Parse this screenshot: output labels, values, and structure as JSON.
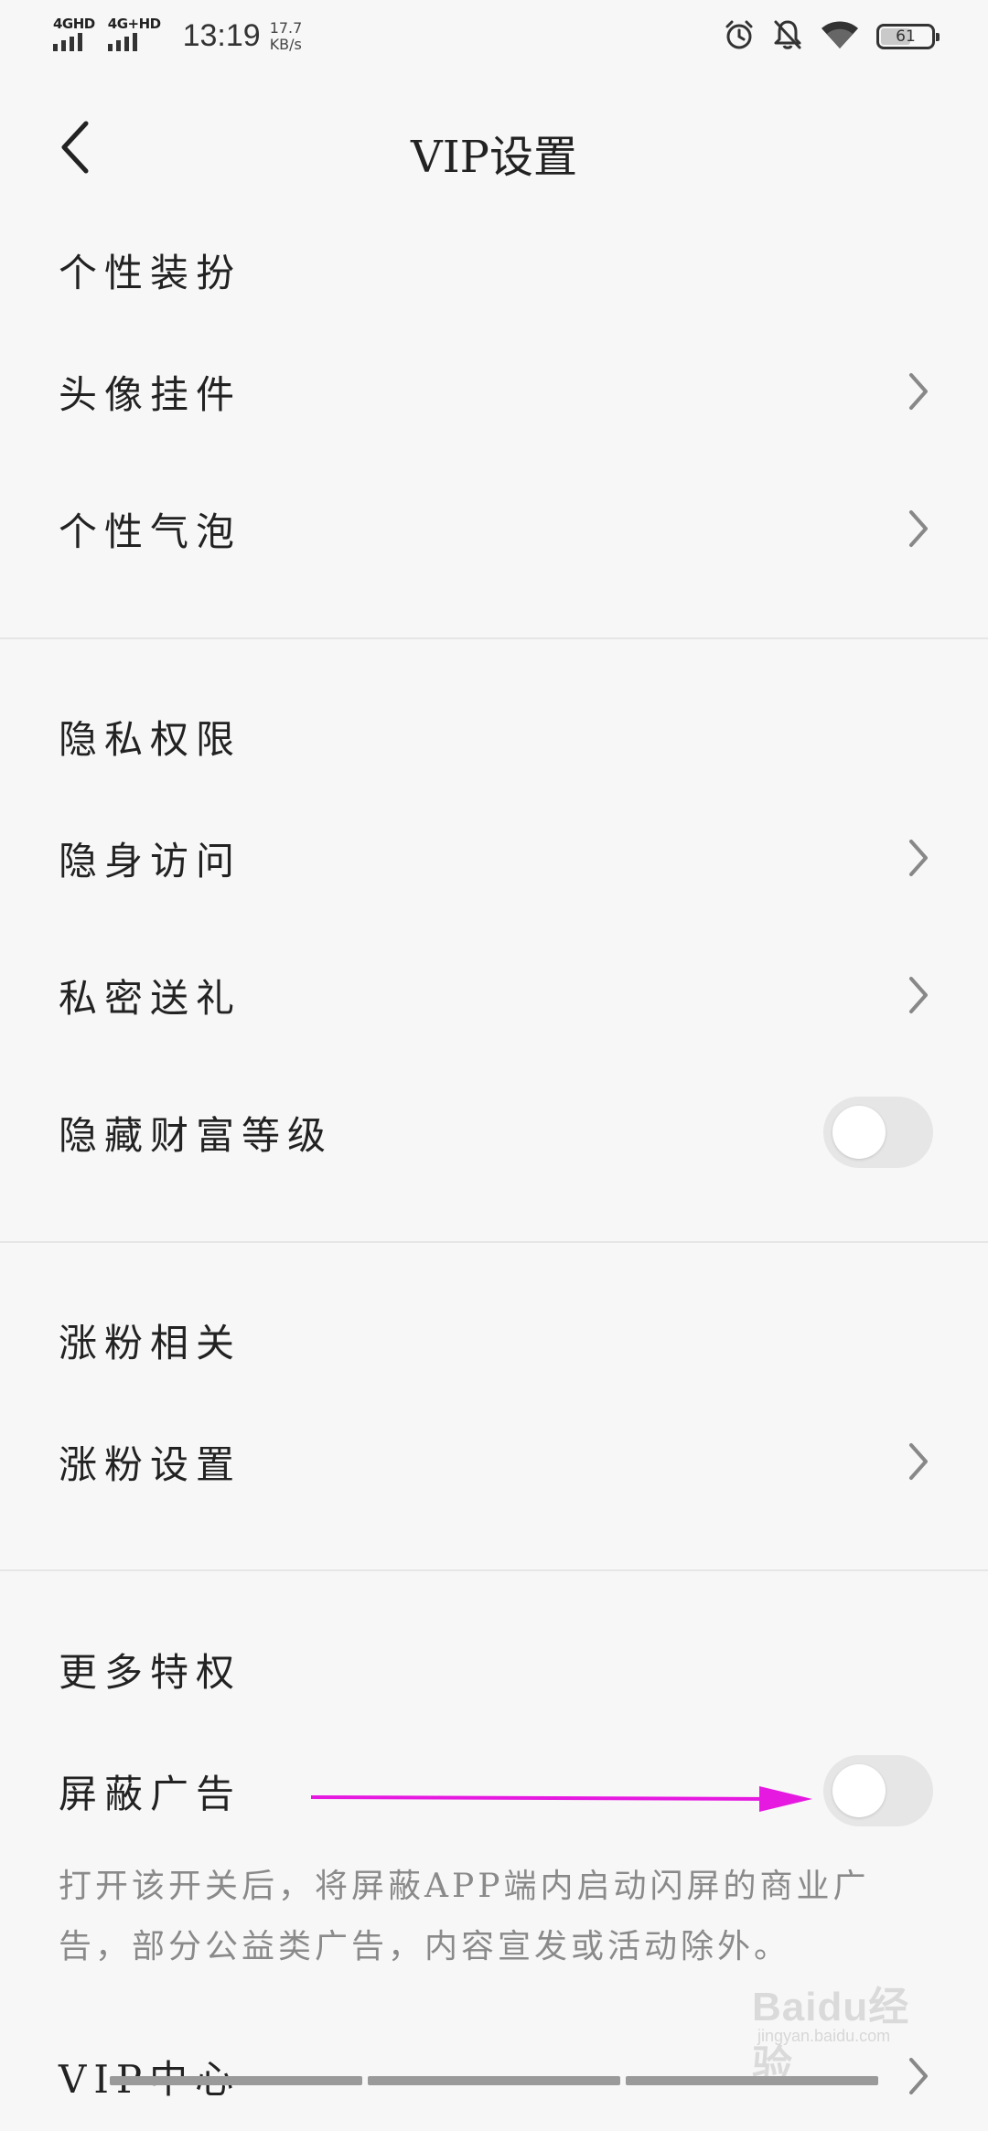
{
  "status_bar": {
    "network1": "4GHD",
    "network2": "4G+HD",
    "time": "13:19",
    "speed_value": "17.7",
    "speed_unit": "KB/s",
    "battery": "61",
    "icons": [
      "alarm-icon",
      "mute-bell-icon",
      "wifi-icon",
      "battery-icon"
    ]
  },
  "header": {
    "title": "VIP设置",
    "back_icon": "chevron-left-icon"
  },
  "sections": {
    "personal": {
      "title": "个性装扮",
      "items": [
        {
          "label": "头像挂件",
          "control": "chevron"
        },
        {
          "label": "个性气泡",
          "control": "chevron"
        }
      ]
    },
    "privacy": {
      "title": "隐私权限",
      "items": [
        {
          "label": "隐身访问",
          "control": "chevron"
        },
        {
          "label": "私密送礼",
          "control": "chevron"
        },
        {
          "label": "隐藏财富等级",
          "control": "toggle",
          "on": false
        }
      ]
    },
    "followers": {
      "title": "涨粉相关",
      "items": [
        {
          "label": "涨粉设置",
          "control": "chevron"
        }
      ]
    },
    "more": {
      "title": "更多特权",
      "items": [
        {
          "label": "屏蔽广告",
          "control": "toggle",
          "on": false
        },
        {
          "label": "VIP中心",
          "control": "chevron"
        }
      ],
      "description": "打开该开关后，将屏蔽APP端内启动闪屏的商业广告，部分公益类广告，内容宣发或活动除外。"
    }
  },
  "annotation": {
    "arrow_color": "#e619e0"
  },
  "watermark": {
    "main": "Baidu经验",
    "sub": "jingyan.baidu.com"
  },
  "colors": {
    "background": "#f7f7f7",
    "toggle_off": "#e6e6e6",
    "divider": "#e6e6e6",
    "description_text": "#8a8a8a"
  }
}
